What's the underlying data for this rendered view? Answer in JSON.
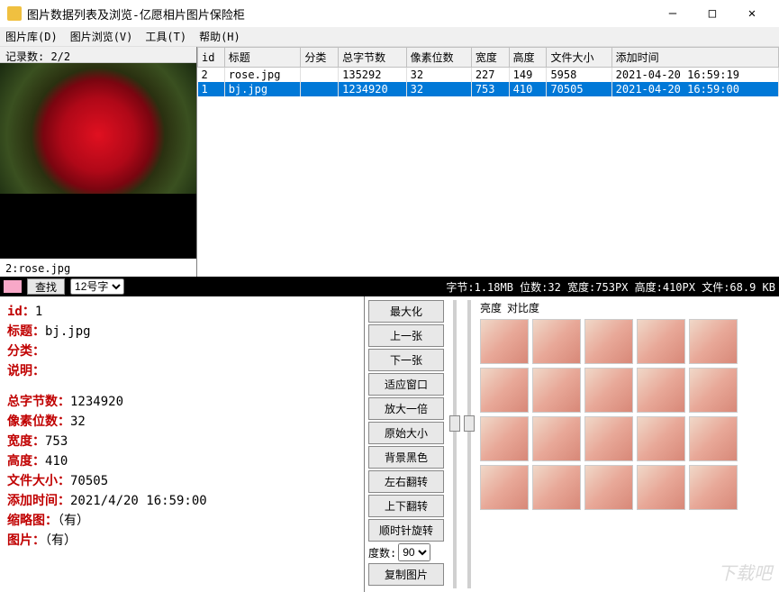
{
  "window": {
    "title": "图片数据列表及浏览-亿愿相片图片保险柜",
    "min": "—",
    "max": "□",
    "close": "✕"
  },
  "menu": {
    "lib": "图片库(D)",
    "browse": "图片浏览(V)",
    "tools": "工具(T)",
    "help": "帮助(H)"
  },
  "record_count": "记录数: 2/2",
  "table": {
    "headers": {
      "id": "id",
      "title": "标题",
      "cat": "分类",
      "bytes": "总字节数",
      "bits": "像素位数",
      "w": "宽度",
      "h": "高度",
      "size": "文件大小",
      "time": "添加时间"
    },
    "rows": [
      {
        "id": "2",
        "title": "rose.jpg",
        "cat": "",
        "bytes": "135292",
        "bits": "32",
        "w": "227",
        "h": "149",
        "size": "5958",
        "time": "2021-04-20 16:59:19"
      },
      {
        "id": "1",
        "title": "bj.jpg",
        "cat": "",
        "bytes": "1234920",
        "bits": "32",
        "w": "753",
        "h": "410",
        "size": "70505",
        "time": "2021-04-20 16:59:00"
      }
    ]
  },
  "preview_label": "2:rose.jpg",
  "findrow": {
    "find_btn": "查找",
    "font_sel": "12号字",
    "info": "字节:1.18MB 位数:32 宽度:753PX 高度:410PX 文件:68.9 KB"
  },
  "detail": {
    "id_l": "id：",
    "id_v": "1",
    "title_l": "标题：",
    "title_v": "bj.jpg",
    "cat_l": "分类：",
    "cat_v": "",
    "desc_l": "说明：",
    "desc_v": "",
    "bytes_l": "总字节数：",
    "bytes_v": "1234920",
    "bits_l": "像素位数：",
    "bits_v": "32",
    "w_l": "宽度：",
    "w_v": "753",
    "h_l": "高度：",
    "h_v": "410",
    "size_l": "文件大小：",
    "size_v": "70505",
    "time_l": "添加时间：",
    "time_v": "2021/4/20 16:59:00",
    "thumb_l": "缩略图：",
    "thumb_v": "（有）",
    "pic_l": "图片：",
    "pic_v": "（有）"
  },
  "btns": {
    "maximize": "最大化",
    "brightness": "亮度",
    "contrast": "对比度",
    "prev": "上一张",
    "next": "下一张",
    "fit": "适应窗口",
    "zoom2x": "放大一倍",
    "origsize": "原始大小",
    "bgblack": "背景黑色",
    "fliph": "左右翻转",
    "flipv": "上下翻转",
    "rotcw": "顺时针旋转",
    "deg_l": "度数:",
    "deg_v": "90",
    "copy": "复制图片"
  }
}
